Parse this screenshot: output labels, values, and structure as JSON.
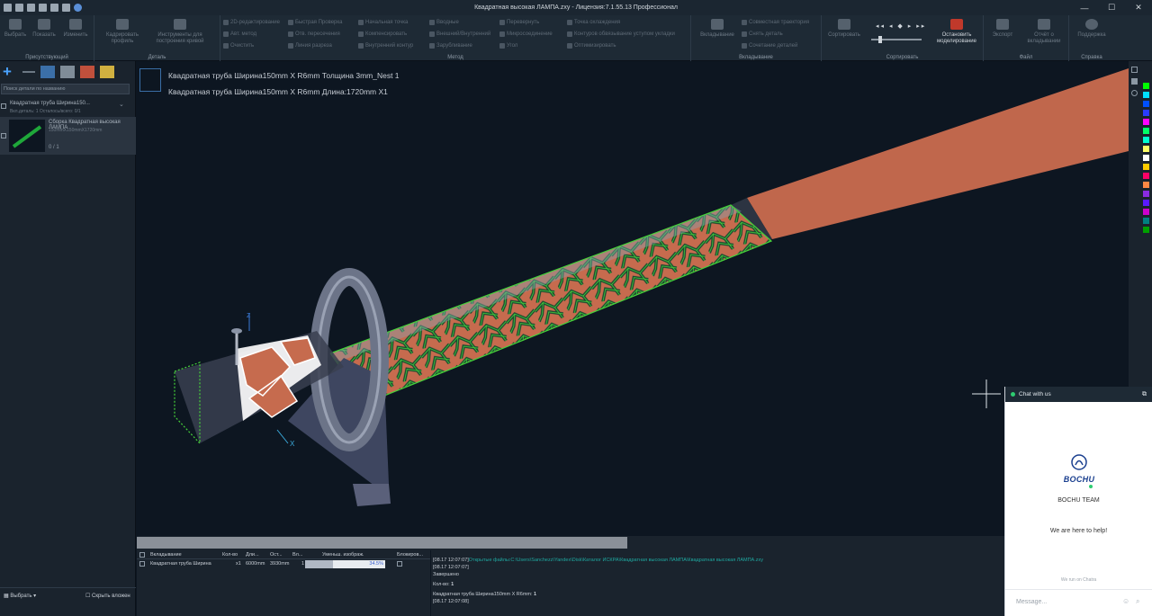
{
  "window": {
    "title": "Квадратная высокая ЛАМПА.zxy - Лицензия:7.1.55.13  Профессионал",
    "min_glyph": "—",
    "max_glyph": "☐",
    "close_glyph": "✕"
  },
  "ribbon": {
    "groups": [
      {
        "label": "Присутствующий"
      },
      {
        "label": "Деталь"
      },
      {
        "label": "Метод"
      },
      {
        "label": "Вкладывание"
      },
      {
        "label": "Сортировать"
      },
      {
        "label": "Файл"
      },
      {
        "label": "Справка"
      }
    ],
    "buttons": {
      "select": "Выбрать",
      "show": "Показать",
      "edit": "Изменить",
      "edit_profile": "Кадрировать профиль",
      "curve_tools": "Инструменты для построения кривой",
      "nesting": "Вкладывание",
      "sort": "Сортировать",
      "stop_sim": "Остановить моделирование",
      "export": "Экспорт",
      "report": "Отчёт о вкладывании",
      "support": "Поддержка"
    },
    "small": {
      "edit2d": "2D-редактирование",
      "auto_method": "Авт. метод",
      "clear": "Очистить",
      "quick_check": "Быстрая Проверка",
      "hole_intersect": "Отв. пересечения",
      "cut_line": "Линия разреза",
      "start_point": "Начальная точка",
      "compensate": "Компенсировать",
      "inner_contour": "Внутренний контур",
      "lead": "Вводные",
      "outer_inner": "Внешний/Внутренний",
      "cut_off": "Зарубливание",
      "reverse": "Перевернуть",
      "micro_joint": "Микросоединение",
      "angle": "Угол",
      "cooling_point": "Точка охлаждения",
      "contour_overlap": "Контуров обвязывание уступом укладки",
      "optimize": "Оптимизировать",
      "common_path": "Совместная траектория",
      "remove_common": "Снять деталь",
      "combine_parts": "Сочетание деталей"
    }
  },
  "left_panel": {
    "search_placeholder": "Поиск детали по названию",
    "part_group": {
      "name": "Квадратная труба Ширина150...",
      "sub": "Вкл.деталь: 1    Осталось/всего: 0/1"
    },
    "part": {
      "title": "Сборка Квадратная высокая ЛАМПА",
      "dims": "150mmX150mmX1720mm",
      "count": "0 / 1"
    },
    "footer": {
      "select": "Выбрать",
      "hide_nested": "Скрыть вложен"
    }
  },
  "viewport": {
    "line1": "Квадратная труба Ширина150mm X R6mm Толщина 3mm_Nest 1",
    "line2": "Квадратная труба Ширина150mm X R6mm Длина:1720mm   X1",
    "axis_x": "X",
    "axis_z": "Z"
  },
  "palette_colors": [
    "#00ff00",
    "#00e0ff",
    "#0050ff",
    "#2a3cff",
    "#ff00ff",
    "#00ff66",
    "#00ffd0",
    "#ffff66",
    "#ffffff",
    "#ffcc00",
    "#ff0066",
    "#ff8844",
    "#8a2be2",
    "#5a1aff",
    "#cc00cc",
    "#008080",
    "#00a000"
  ],
  "bottom_table": {
    "headers": [
      "Вкладывание",
      "Кол-во",
      "Дли...",
      "Ост...",
      "Вл...",
      "Уменьш. изображ.",
      "Блокиров..."
    ],
    "row": {
      "name": "Квадратная труба Ширина",
      "qty": "x1",
      "length": "6000mm",
      "remain": "3930mm",
      "nested": "1",
      "percent": "34.5%"
    },
    "progress": 0.345
  },
  "log": {
    "line1_time": "[08.17 12:07:07]",
    "line1_text": "Открытые файлы:C:\\Users\\Sanchezz\\Yandex\\Disk\\Каталог ИСКРА\\Квадратная высокая ЛАМПА\\Квадратная высокая ЛАМПА.zxy",
    "line2_time": "[08.17 12:07:07]",
    "line2_text": "Завершено",
    "line3_label": "Кол-во:",
    "line3_value": "1",
    "line4_label": "Квадратная труба Ширина150mm X R6mm:",
    "line4_value": "1",
    "line5_time": "[08.17 12:07:08]"
  },
  "chat": {
    "header": "Chat with us",
    "brand": "BOCHU",
    "team": "BOCHU TEAM",
    "help": "We are here to help!",
    "powered": "We run on Chatra",
    "placeholder": "Message..."
  }
}
